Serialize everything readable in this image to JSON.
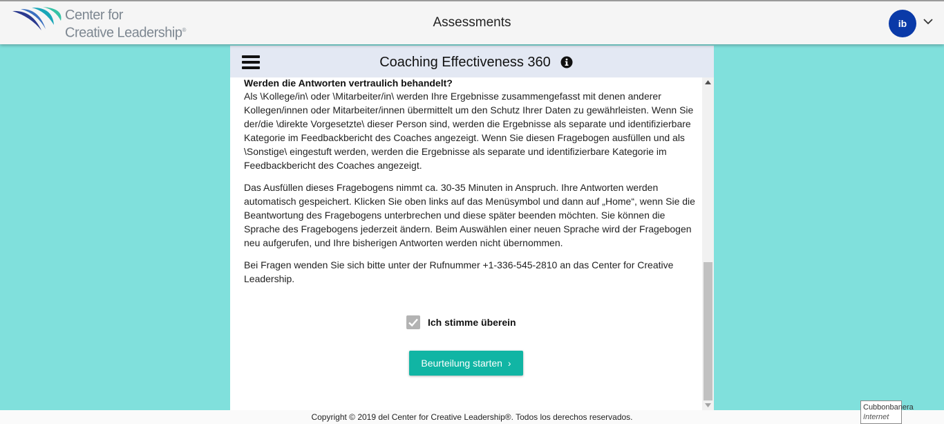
{
  "header": {
    "logo_line1": "Center for",
    "logo_line2": "Creative Leadership",
    "logo_tm": "®",
    "title": "Assessments",
    "avatar_initials": "ib"
  },
  "panel": {
    "title": "Coaching Effectiveness 360",
    "heading": "Werden die Antworten vertraulich behandelt?",
    "paragraphs": [
      "Als \\Kollege/in\\ oder \\Mitarbeiter/in\\ werden Ihre Ergebnisse zusammengefasst mit denen anderer Kollegen/innen oder Mitarbeiter/innen übermittelt um den Schutz Ihrer Daten zu gewährleisten. Wenn Sie der/die \\direkte Vorgesetzte\\ dieser Person sind, werden die Ergebnisse als separate und identifizierbare Kategorie im Feedbackbericht des Coaches angezeigt. Wenn Sie diesen Fragebogen ausfüllen und als \\Sonstige\\ eingestuft werden, werden die Ergebnisse als separate und identifizierbare Kategorie im Feedbackbericht des Coaches angezeigt.",
      "Das Ausfüllen dieses Fragebogens nimmt ca. 30-35 Minuten in Anspruch. Ihre Antworten werden automatisch gespeichert. Klicken Sie oben links auf das Menüsymbol und dann auf „Home“, wenn Sie die Beantwortung des Fragebogens unterbrechen und diese später beenden möchten. Sie können die Sprache des Fragebogens jederzeit ändern. Beim Auswählen einer neuen Sprache wird der Fragebogen neu aufgerufen, und Ihre bisherigen Antworten werden nicht übernommen.",
      "Bei Fragen wenden Sie sich bitte unter der Rufnummer +1-336-545-2810 an das Center for Creative Leadership."
    ],
    "agree_label": "Ich stimme überein",
    "agree_checked": true,
    "start_button": "Beurteilung starten",
    "start_chevron": "›"
  },
  "footer": {
    "copyright": "Copyright © 2019 del Center for Creative Leadership®. Todos los derechos reservados."
  },
  "tooltip": {
    "line1": "Cubbonbanera",
    "line2": "Internet access"
  },
  "colors": {
    "background": "#80e0dc",
    "accent": "#11b5a4",
    "avatar": "#0a3aa8",
    "panel_header": "#e3e8f3"
  },
  "icons": [
    "ccl-logo-icon",
    "avatar-chevron-down-icon",
    "menu-icon",
    "info-icon",
    "checkmark-icon",
    "chevron-right-icon"
  ]
}
